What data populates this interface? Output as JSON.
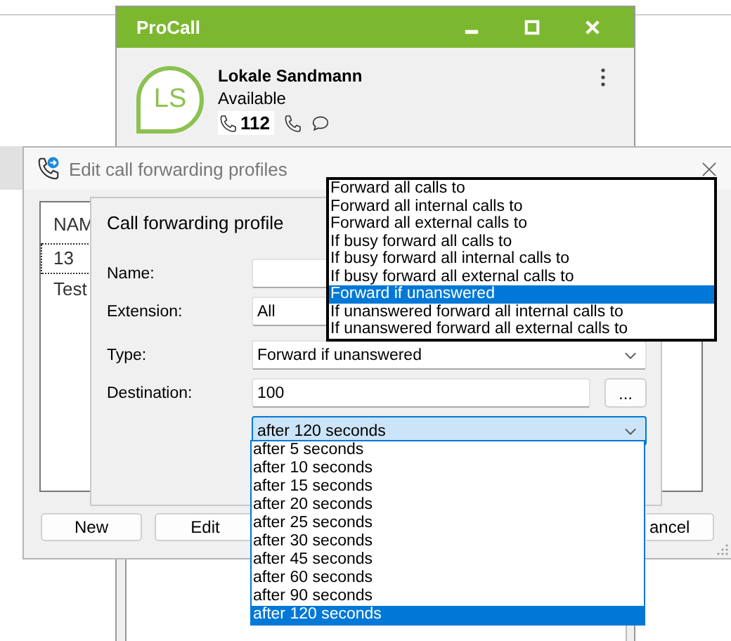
{
  "procall": {
    "title": "ProCall",
    "avatar_initials": "LS",
    "name": "Lokale Sandmann",
    "status": "Available",
    "extension": "112"
  },
  "edit_dialog": {
    "title": "Edit call forwarding profiles",
    "list": {
      "header": "NAM",
      "rows": [
        {
          "text": "13",
          "focused": true
        },
        {
          "text": "Test",
          "focused": false
        }
      ]
    },
    "buttons": [
      "New",
      "Edit",
      "ancel"
    ]
  },
  "profile_dialog": {
    "title": "Call forwarding profile",
    "fields": [
      {
        "label": "Name:",
        "kind": "text"
      },
      {
        "label": "Extension:",
        "kind": "text",
        "value": "All"
      },
      {
        "label": "Type:",
        "kind": "combo",
        "value": "Forward if unanswered"
      },
      {
        "label": "Destination:",
        "kind": "browse",
        "value": "100",
        "button": "..."
      },
      {
        "kind": "open-combo",
        "value": "after 120 seconds"
      }
    ]
  },
  "type_options": [
    {
      "text": "Forward all calls to",
      "selected": false
    },
    {
      "text": "Forward all internal calls to",
      "selected": false
    },
    {
      "text": "Forward all external calls to",
      "selected": false
    },
    {
      "text": "If busy forward all calls to",
      "selected": false
    },
    {
      "text": "If busy forward all internal calls to",
      "selected": false
    },
    {
      "text": "If busy forward all external calls to",
      "selected": false
    },
    {
      "text": "Forward if unanswered",
      "selected": true
    },
    {
      "text": "If unanswered forward all internal calls to",
      "selected": false
    },
    {
      "text": "If unanswered forward all external calls to",
      "selected": false
    }
  ],
  "delay_options": [
    {
      "text": "after 5 seconds",
      "selected": false
    },
    {
      "text": "after 10 seconds",
      "selected": false
    },
    {
      "text": "after 15 seconds",
      "selected": false
    },
    {
      "text": "after 20 seconds",
      "selected": false
    },
    {
      "text": "after 25 seconds",
      "selected": false
    },
    {
      "text": "after 30 seconds",
      "selected": false
    },
    {
      "text": "after 45 seconds",
      "selected": false
    },
    {
      "text": "after 60 seconds",
      "selected": false
    },
    {
      "text": "after 90 seconds",
      "selected": false
    },
    {
      "text": "after 120 seconds",
      "selected": true
    }
  ]
}
